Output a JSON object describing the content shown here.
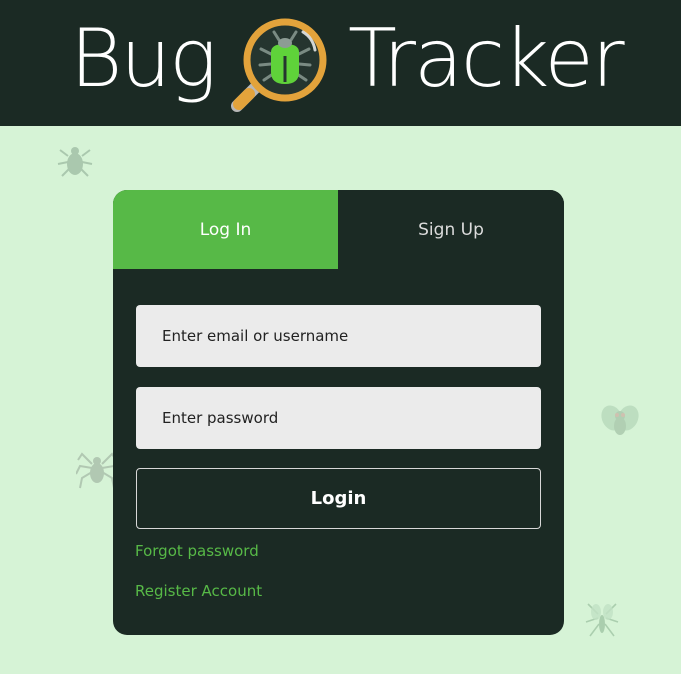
{
  "header": {
    "title_part1": "Bug",
    "title_part2": "Tracker",
    "logo_icon": "magnifier-bug-icon"
  },
  "tabs": [
    {
      "label": "Log In",
      "active": true
    },
    {
      "label": "Sign Up",
      "active": false
    }
  ],
  "form": {
    "email_placeholder": "Enter email or username",
    "password_placeholder": "Enter password",
    "login_label": "Login",
    "forgot_label": "Forgot password",
    "register_label": "Register Account"
  },
  "colors": {
    "header_bg": "#1b2a24",
    "page_bg": "#d6f3d6",
    "accent": "#57b947",
    "magnifier": "#e3a33b"
  }
}
